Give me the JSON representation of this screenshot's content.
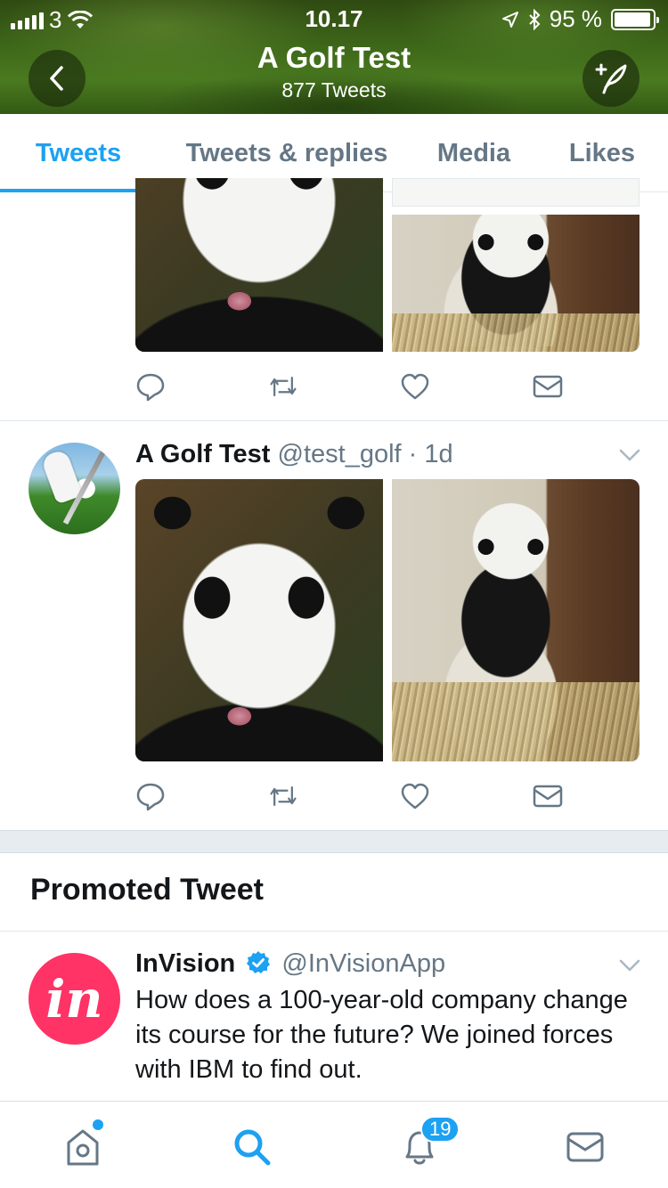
{
  "status_bar": {
    "carrier": "3",
    "time": "10.17",
    "battery_percent": "95 %",
    "battery_level": 0.95
  },
  "header": {
    "title": "A Golf Test",
    "subtitle": "877 Tweets",
    "back_icon": "chevron-left-icon",
    "compose_icon": "compose-tweet-icon"
  },
  "tabs": [
    {
      "label": "Tweets",
      "active": true
    },
    {
      "label": "Tweets & replies",
      "active": false
    },
    {
      "label": "Media",
      "active": false
    },
    {
      "label": "Likes",
      "active": false
    }
  ],
  "tweets": [
    {
      "name": "A Golf Test",
      "handle": "@test_golf",
      "separator": "·",
      "time": "1d",
      "photos": [
        "panda-face",
        "panda-tree"
      ]
    }
  ],
  "promoted": {
    "section_title": "Promoted Tweet",
    "name": "InVision",
    "handle": "@InVisionApp",
    "avatar_text": "in",
    "text": "How does a 100-year-old company change its course for the future? We joined forces with IBM to find out."
  },
  "bottom_nav": {
    "items": [
      "home-icon",
      "search-icon",
      "notifications-icon",
      "messages-icon"
    ],
    "notification_count": "19"
  },
  "colors": {
    "accent": "#1da1f2",
    "muted": "#657786",
    "invision": "#ff3366"
  }
}
